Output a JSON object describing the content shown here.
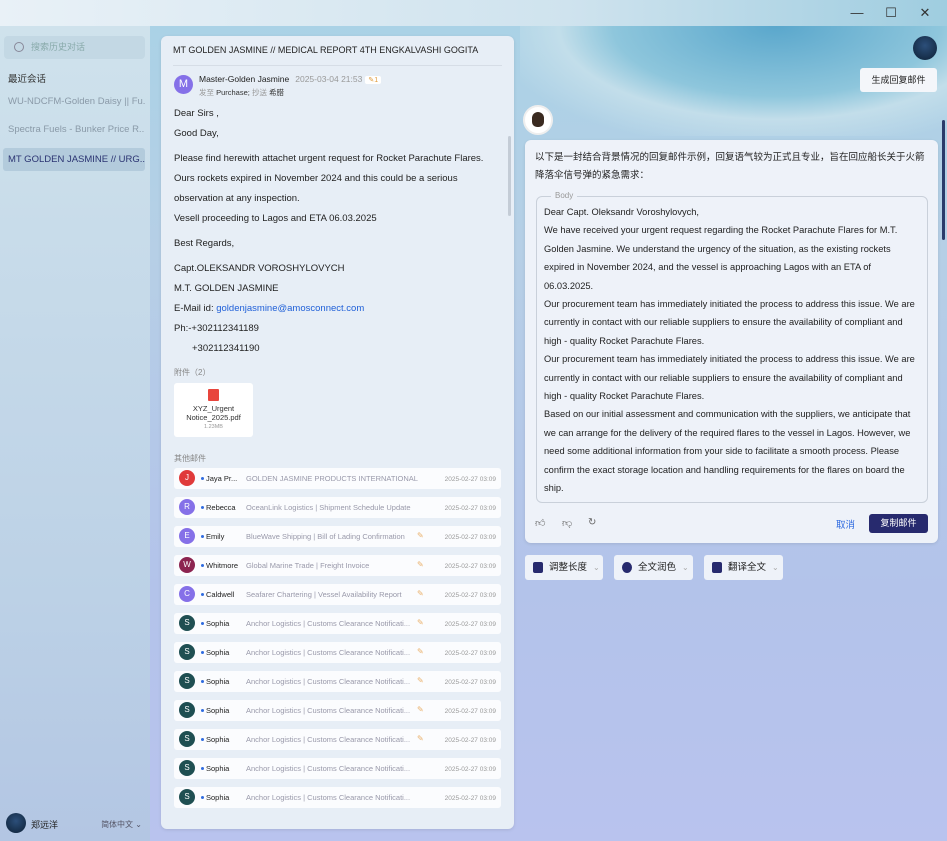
{
  "window": {
    "minimize": "—",
    "maximize": "☐",
    "close": "✕"
  },
  "sidebar": {
    "search_placeholder": "搜索历史对话",
    "recent_label": "最近会话",
    "items": [
      {
        "label": "WU-NDCFM-Golden Daisy || Fu..."
      },
      {
        "label": "Spectra Fuels - Bunker Price R..."
      },
      {
        "label": "MT GOLDEN JASMINE // URG..."
      }
    ],
    "user_name": "郑远洋",
    "language": "简体中文"
  },
  "mail": {
    "title": "MT GOLDEN JASMINE // MEDICAL REPORT 4TH ENGKALVASHI GOGITA",
    "sender_initial": "M",
    "sender": "Master-Golden Jasmine",
    "date": "2025-03-04 21:53",
    "attach_badge": "1",
    "to_label": "发至",
    "to": "Purchase;",
    "cc_label": "抄送",
    "cc": "希腊",
    "body": [
      "Dear Sirs ,",
      "Good Day,",
      "Please find herewith attachet urgent request for Rocket Parachute Flares.",
      "Ours rockets expired in November 2024 and this could be a serious observation at any inspection.",
      "Vesell proceeding to Lagos and ETA 06.03.2025",
      "Best Regards,",
      "Capt.OLEKSANDR VOROSHYLOVYCH",
      "M.T. GOLDEN JASMINE"
    ],
    "email_label": "E-Mail id: ",
    "email": "goldenjasmine@amosconnect.com",
    "phone1": "Ph:-+302112341189",
    "phone2": "+302112341190",
    "attachments_label": "附件（2）",
    "attachment": {
      "name": "XYZ_Urgent Notice_2025.pdf",
      "size": "1.23MB"
    },
    "others_label": "其他邮件",
    "others": [
      {
        "initial": "J",
        "color": "#e03a3a",
        "name": "Jaya Pr...",
        "subject": "GOLDEN JASMINE PRODUCTS INTERNATIONAL",
        "clip": false,
        "date": "2025-02-27 03:09"
      },
      {
        "initial": "R",
        "color": "#8570e8",
        "name": "Rebecca",
        "subject": "OceanLink Logistics | Shipment Schedule Update",
        "clip": false,
        "date": "2025-02-27 03:09"
      },
      {
        "initial": "E",
        "color": "#8570e8",
        "name": "Emily",
        "subject": "BlueWave Shipping | Bill of Lading Confirmation",
        "clip": true,
        "date": "2025-02-27 03:09"
      },
      {
        "initial": "W",
        "color": "#8c2450",
        "name": "Whitmore",
        "subject": "Global Marine Trade | Freight Invoice",
        "clip": true,
        "date": "2025-02-27 03:09"
      },
      {
        "initial": "C",
        "color": "#8570e8",
        "name": "Caldwell",
        "subject": "Seafarer Chartering | Vessel Availability Report",
        "clip": true,
        "date": "2025-02-27 03:09"
      },
      {
        "initial": "S",
        "color": "#1f4f52",
        "name": "Sophia",
        "subject": "Anchor Logistics | Customs Clearance Notificati...",
        "clip": true,
        "date": "2025-02-27 03:09"
      },
      {
        "initial": "S",
        "color": "#1f4f52",
        "name": "Sophia",
        "subject": "Anchor Logistics | Customs Clearance Notificati...",
        "clip": true,
        "date": "2025-02-27 03:09"
      },
      {
        "initial": "S",
        "color": "#1f4f52",
        "name": "Sophia",
        "subject": "Anchor Logistics | Customs Clearance Notificati...",
        "clip": true,
        "date": "2025-02-27 03:09"
      },
      {
        "initial": "S",
        "color": "#1f4f52",
        "name": "Sophia",
        "subject": "Anchor Logistics | Customs Clearance Notificati...",
        "clip": true,
        "date": "2025-02-27 03:09"
      },
      {
        "initial": "S",
        "color": "#1f4f52",
        "name": "Sophia",
        "subject": "Anchor Logistics | Customs Clearance Notificati...",
        "clip": true,
        "date": "2025-02-27 03:09"
      },
      {
        "initial": "S",
        "color": "#1f4f52",
        "name": "Sophia",
        "subject": "Anchor Logistics | Customs Clearance Notificati...",
        "clip": false,
        "date": "2025-02-27 03:09"
      },
      {
        "initial": "S",
        "color": "#1f4f52",
        "name": "Sophia",
        "subject": "Anchor Logistics | Customs Clearance Notificati...",
        "clip": false,
        "date": "2025-02-27 03:09"
      }
    ]
  },
  "assistant": {
    "generate_label": "生成回复邮件",
    "intro": "以下是一封结合背景情况的回复邮件示例，回复语气较为正式且专业，旨在回应船长关于火箭降落伞信号弹的紧急需求：",
    "body_label": "Body",
    "reply": [
      "Dear Capt. Oleksandr Voroshylovych,",
      "We have received your urgent request regarding the Rocket Parachute Flares for M.T. Golden Jasmine. We understand the urgency of the situation, as the existing rockets expired in November 2024, and the vessel is approaching Lagos with an ETA of 06.03.2025.",
      "Our procurement team has immediately initiated the process to address this issue. We are currently in contact with our reliable suppliers to ensure the availability of compliant and high - quality Rocket Parachute Flares.",
      "Our procurement team has immediately initiated the process to address this issue. We are currently in contact with our reliable suppliers to ensure the availability of compliant and high - quality Rocket Parachute Flares.",
      "Based on our initial assessment and communication with the suppliers, we anticipate that we can arrange for the delivery of the required flares to the vessel in Lagos. However, we need some additional information from your side to facilitate a smooth process. Please confirm the exact storage location and handling requirements for the flares on board the ship."
    ],
    "cancel_label": "取消",
    "copy_label": "复制邮件",
    "tools": [
      {
        "label": "调整长度"
      },
      {
        "label": "全文润色"
      },
      {
        "label": "翻译全文"
      }
    ]
  }
}
